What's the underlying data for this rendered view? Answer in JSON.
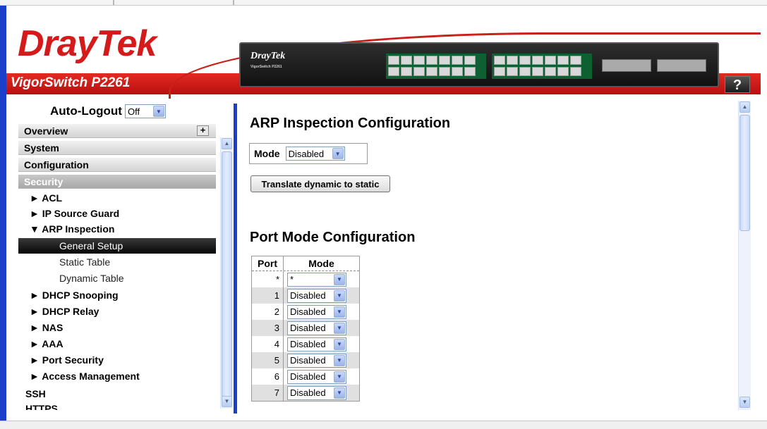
{
  "brand": {
    "logo_text": "DrayTek",
    "model": "VigorSwitch P2261",
    "device_logo": "DrayTek",
    "device_sub": "VigorSwitch P2261"
  },
  "help_label": "?",
  "sidebar": {
    "auto_logout_label": "Auto-Logout",
    "auto_logout_value": "Off",
    "overview": "Overview",
    "expand_symbol": "+",
    "system": "System",
    "configuration": "Configuration",
    "security": "Security",
    "items": [
      "► ACL",
      "► IP Source Guard",
      "▼ ARP Inspection"
    ],
    "arp_children": [
      "General Setup",
      "Static Table",
      "Dynamic Table"
    ],
    "items_after": [
      "► DHCP Snooping",
      "► DHCP Relay",
      "► NAS",
      "► AAA",
      "► Port Security",
      "► Access Management"
    ],
    "ssh": "SSH",
    "https": "HTTPS"
  },
  "main": {
    "title": "ARP Inspection Configuration",
    "mode_label": "Mode",
    "mode_value": "Disabled",
    "translate_button": "Translate dynamic to static",
    "port_title": "Port Mode Configuration",
    "port_headers": [
      "Port",
      "Mode"
    ],
    "port_rows": [
      {
        "port": "*",
        "mode": "*"
      },
      {
        "port": "1",
        "mode": "Disabled"
      },
      {
        "port": "2",
        "mode": "Disabled"
      },
      {
        "port": "3",
        "mode": "Disabled"
      },
      {
        "port": "4",
        "mode": "Disabled"
      },
      {
        "port": "5",
        "mode": "Disabled"
      },
      {
        "port": "6",
        "mode": "Disabled"
      },
      {
        "port": "7",
        "mode": "Disabled"
      }
    ]
  },
  "colors": {
    "brand_red": "#d41a1a",
    "frame_blue": "#1c3fc9",
    "active_menu_bg": "#000000"
  }
}
